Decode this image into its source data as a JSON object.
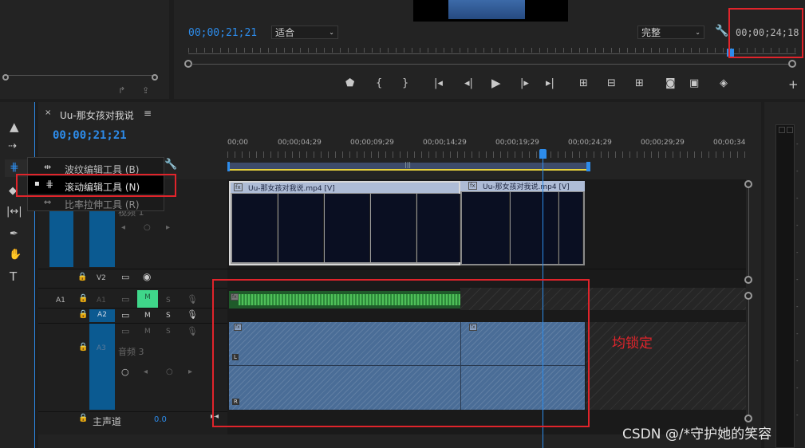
{
  "monitor": {
    "timecode_left": "00;00;21;21",
    "fit_value": "适合",
    "quality_value": "完整",
    "timecode_right": "00;00;24;18"
  },
  "sequence": {
    "name": "Uu-那女孩对我说",
    "timecode": "00;00;21;21",
    "ruler_ticks": [
      "00;00",
      "00;00;04;29",
      "00;00;09;29",
      "00;00;14;29",
      "00;00;19;29",
      "00;00;24;29",
      "00;00;29;29",
      "00;00;34"
    ]
  },
  "tool_menu": {
    "items": [
      {
        "label": "波纹编辑工具 (B)",
        "selected": false
      },
      {
        "label": "滚动编辑工具 (N)",
        "selected": true
      },
      {
        "label": "比率拉伸工具 (R)",
        "selected": false
      }
    ]
  },
  "tracks": {
    "v2": "V2",
    "a1_src": "A1",
    "a1": "A1",
    "a2": "A2",
    "a3": "A3",
    "a3_name": "音频 3",
    "v1_name": "视频 1",
    "m": "M",
    "s": "S",
    "master_label": "主声道",
    "master_value": "0.0"
  },
  "clips": {
    "video1": "Uu-那女孩对我说.mp4 [V]",
    "video2": "Uu-那女孩对我说.mp4 [V]",
    "fx": "fx"
  },
  "annotation": "均锁定",
  "watermark": "CSDN @/*守护她的笑容",
  "colors": {
    "accent_blue": "#2d8ceb",
    "red_box": "#e0242b",
    "audio_green": "#3ea54a",
    "audio_blue": "#4a6d97"
  }
}
